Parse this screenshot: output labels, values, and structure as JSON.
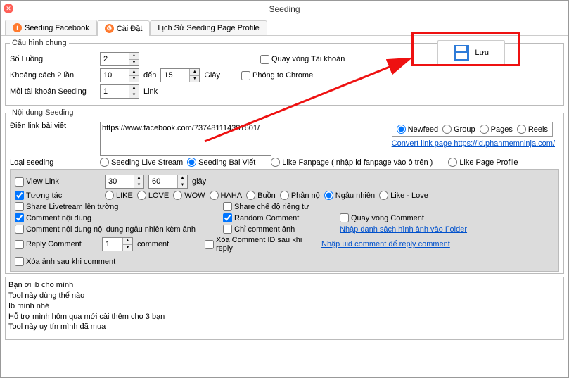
{
  "title": "Seeding",
  "tabs": {
    "t0": "Seeding Facebook",
    "t1": "Cài Đặt",
    "t2": "Lịch Sử Seeding Page Profile"
  },
  "cfg": {
    "legend": "Cấu hình chung",
    "threads_lbl": "Số Luồng",
    "threads": "2",
    "gap_lbl": "Khoảng cách 2 lần",
    "gap_from": "10",
    "gap_to_lbl": "đến",
    "gap_to": "15",
    "gap_unit": "Giây",
    "peracc_lbl": "Mỗi tài khoản Seeding",
    "peracc": "1",
    "peracc_unit": "Link",
    "loop_acc": "Quay vòng Tài khoản",
    "big_chrome": "Phóng to Chrome",
    "save": "Lưu"
  },
  "nd": {
    "legend": "Nội dung Seeding",
    "postlink_lbl": "Điền link bài viết",
    "postlink": "https://www.facebook.com/737481114381601/",
    "src": {
      "newfeed": "Newfeed",
      "group": "Group",
      "pages": "Pages",
      "reels": "Reels"
    },
    "convert_link": "Convert link page https://id.phanmemninja.com/",
    "type_lbl": "Loại seeding",
    "type": {
      "live": "Seeding Live Stream",
      "post": "Seeding Bài Viết",
      "likefp": "Like Fanpage ( nhập id fanpage vào ô trên )",
      "likepp": "Like Page Profile"
    },
    "view_lbl": "View Link",
    "view_from": "30",
    "view_to": "60",
    "view_unit": "giây",
    "react_lbl": "Tương tác",
    "react": {
      "like": "LIKE",
      "love": "LOVE",
      "wow": "WOW",
      "haha": "HAHA",
      "sad": "Buồn",
      "angry": "Phẫn nộ",
      "rand": "Ngẫu nhiên",
      "likelove": "Like - Love"
    },
    "share_wall": "Share Livetream lên tường",
    "share_priv": "Share chế độ riêng tư",
    "cmt": "Comment nội dung",
    "rand_cmt": "Random Comment",
    "loop_cmt": "Quay vòng Comment",
    "cmt_img": "Comment nội dung nội dung ngẫu nhiên kèm ảnh",
    "only_img": "Chỉ comment ảnh",
    "img_folder": "Nhập danh sách hình ảnh vào Folder",
    "reply_lbl": "Reply Comment",
    "reply_n": "1",
    "reply_unit": "comment",
    "del_after": "Xóa Comment ID sau khi reply",
    "reply_uid": "Nhập uid comment để reply comment",
    "del_img": "Xóa ảnh sau khi comment"
  },
  "footer": {
    "l0": "Bạn ơi ib cho mình",
    "l1": "Tool này dùng thế nào",
    "l2": "Ib mình nhé",
    "l3": "Hỗ trợ mình hôm qua mới cài thêm cho 3 bạn",
    "l4": "Tool này uy tín mình đã mua"
  }
}
